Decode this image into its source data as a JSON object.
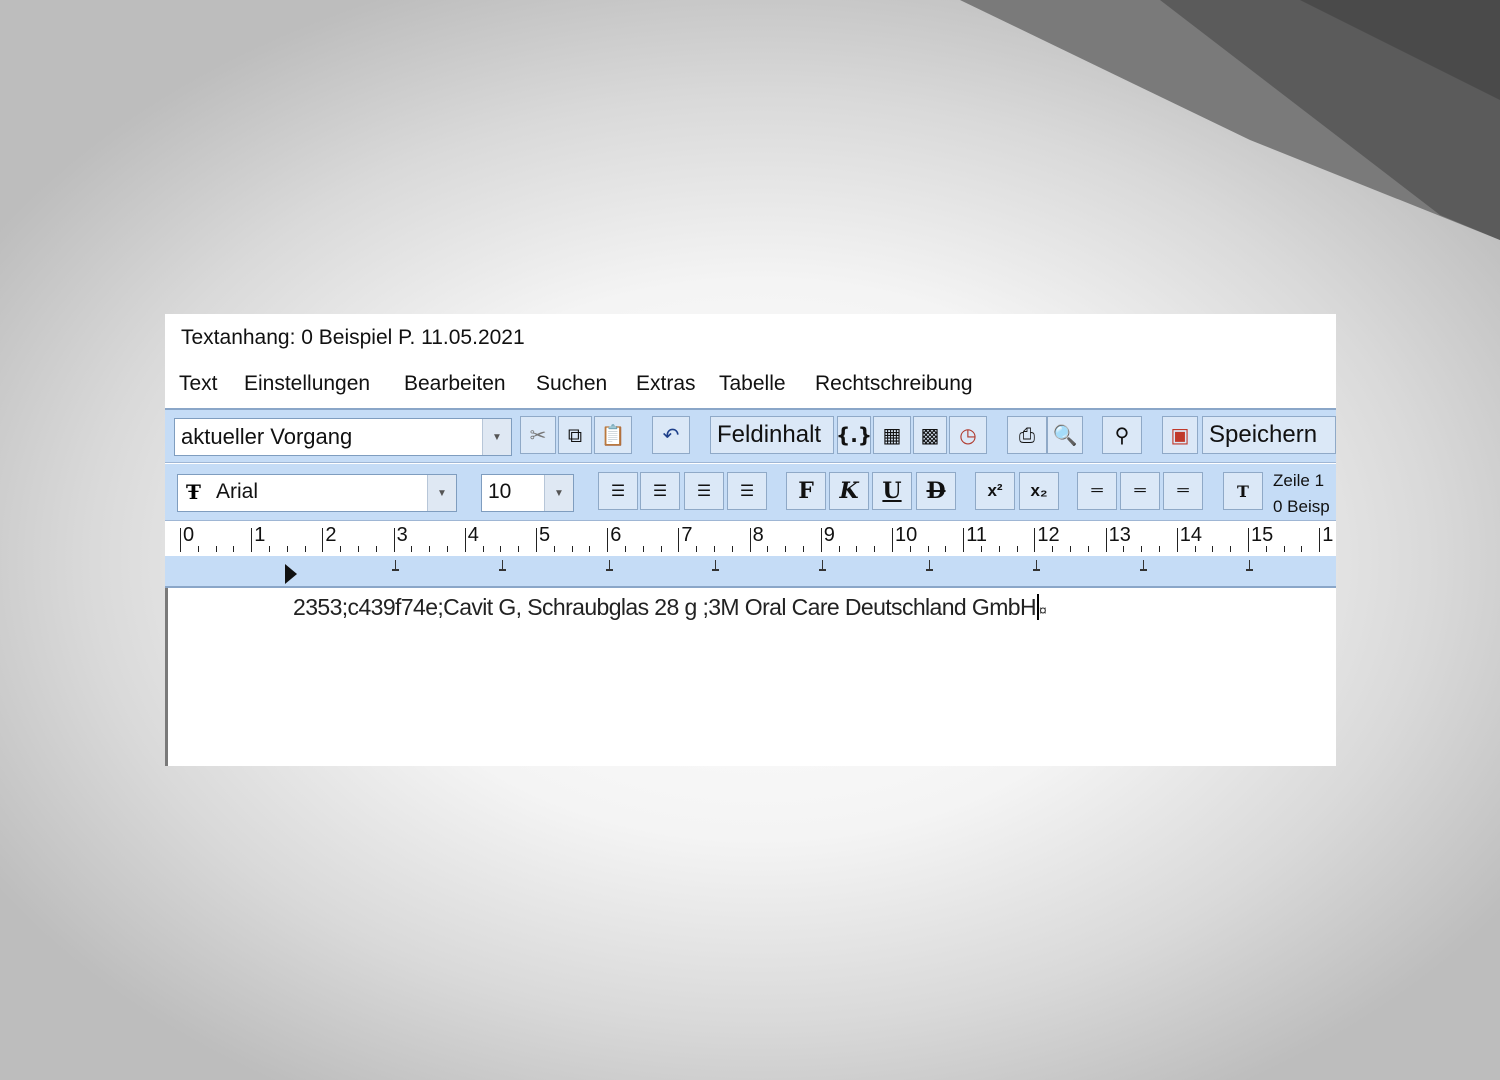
{
  "window": {
    "title": "Textanhang: 0 Beispiel P. 11.05.2021"
  },
  "menu": [
    "Text",
    "Einstellungen",
    "Bearbeiten",
    "Suchen",
    "Extras",
    "Tabelle",
    "Rechtschreibung"
  ],
  "toolbar": {
    "context_select": "aktueller Vorgang",
    "field_button": "Feldinhalt",
    "save_button": "Speichern"
  },
  "format": {
    "font": "Arial",
    "size": "10",
    "bold_label": "F",
    "italic_label": "K",
    "underline_label": "U",
    "strike_label": "D",
    "superscript_label": "x²",
    "subscript_label": "x₂"
  },
  "status": {
    "line": "Zeile 1",
    "doc": "0 Beisp"
  },
  "ruler": {
    "numbers": [
      "0",
      "1",
      "2",
      "3",
      "4",
      "5",
      "6",
      "7",
      "8",
      "9",
      "10",
      "11",
      "12",
      "13",
      "14",
      "15",
      "1"
    ]
  },
  "editor": {
    "text": "2353;c439f74e;Cavit G, Schraubglas 28 g ;3M Oral Care Deutschland GmbH",
    "end_mark": "¤"
  },
  "colors": {
    "toolbar_bg": "#c5dcf6",
    "deco_dark": "#5a5a5a"
  }
}
